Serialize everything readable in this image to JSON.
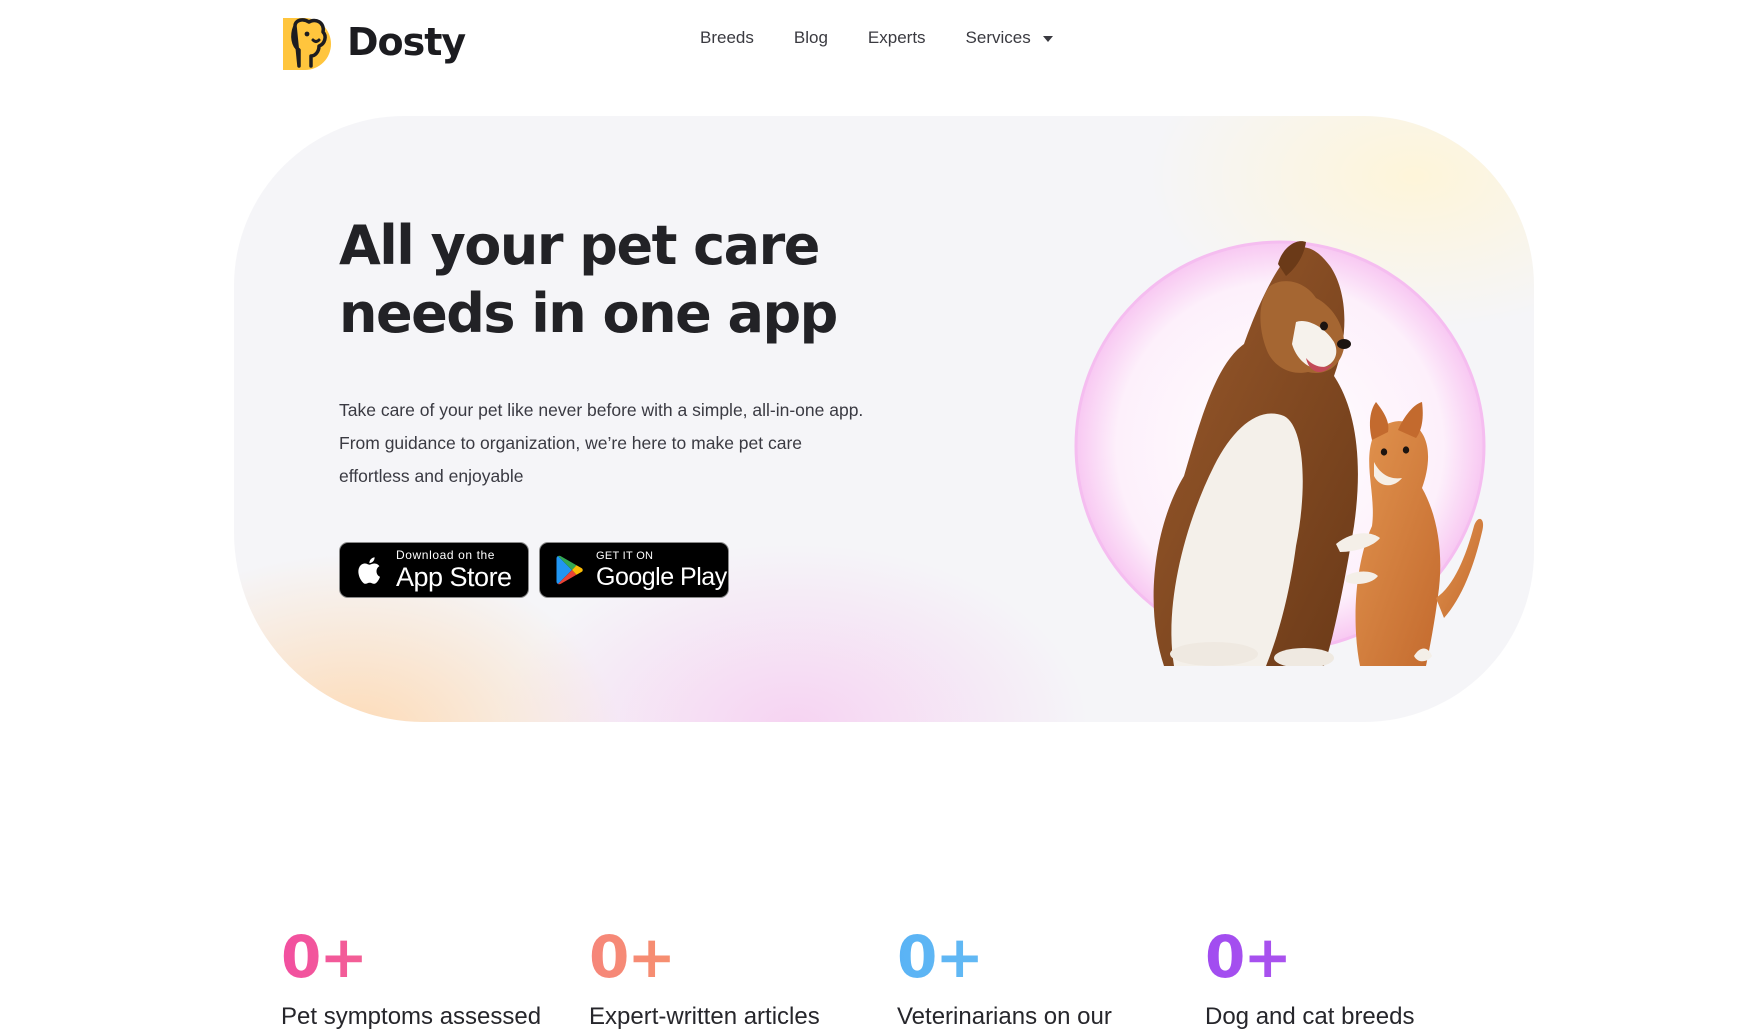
{
  "brand": {
    "name": "Dosty",
    "logo_color": "#FFC53D"
  },
  "nav": {
    "items": [
      {
        "label": "Breeds"
      },
      {
        "label": "Blog"
      },
      {
        "label": "Experts"
      },
      {
        "label": "Services",
        "has_dropdown": true
      }
    ]
  },
  "hero": {
    "title_line1": "All your pet care",
    "title_line2": "needs in one app",
    "description_line1": "Take care of your pet like never before with a simple, all-in-one app.",
    "description_line2": "From guidance to organization, we’re here to make pet care",
    "description_line3": "effortless and enjoyable",
    "app_store": {
      "small": "Download on the",
      "big": "App Store",
      "icon": "apple-icon"
    },
    "google_play": {
      "small": "GET IT ON",
      "big": "Google Play",
      "icon": "google-play-icon"
    },
    "image": "dog-and-cat-illustration"
  },
  "stats": [
    {
      "number": "0+",
      "label": "Pet symptoms assessed",
      "gradient": [
        "#F24FA0",
        "#F58A7A"
      ]
    },
    {
      "number": "0+",
      "label": "Expert-written articles",
      "gradient": [
        "#F6867A",
        "#F7A655"
      ]
    },
    {
      "number": "0+",
      "label": "Veterinarians on our",
      "gradient": [
        "#5AB3F5",
        "#78C8F0"
      ]
    },
    {
      "number": "0+",
      "label": "Dog and cat breeds",
      "gradient": [
        "#A14CF0",
        "#C264E8"
      ]
    }
  ]
}
